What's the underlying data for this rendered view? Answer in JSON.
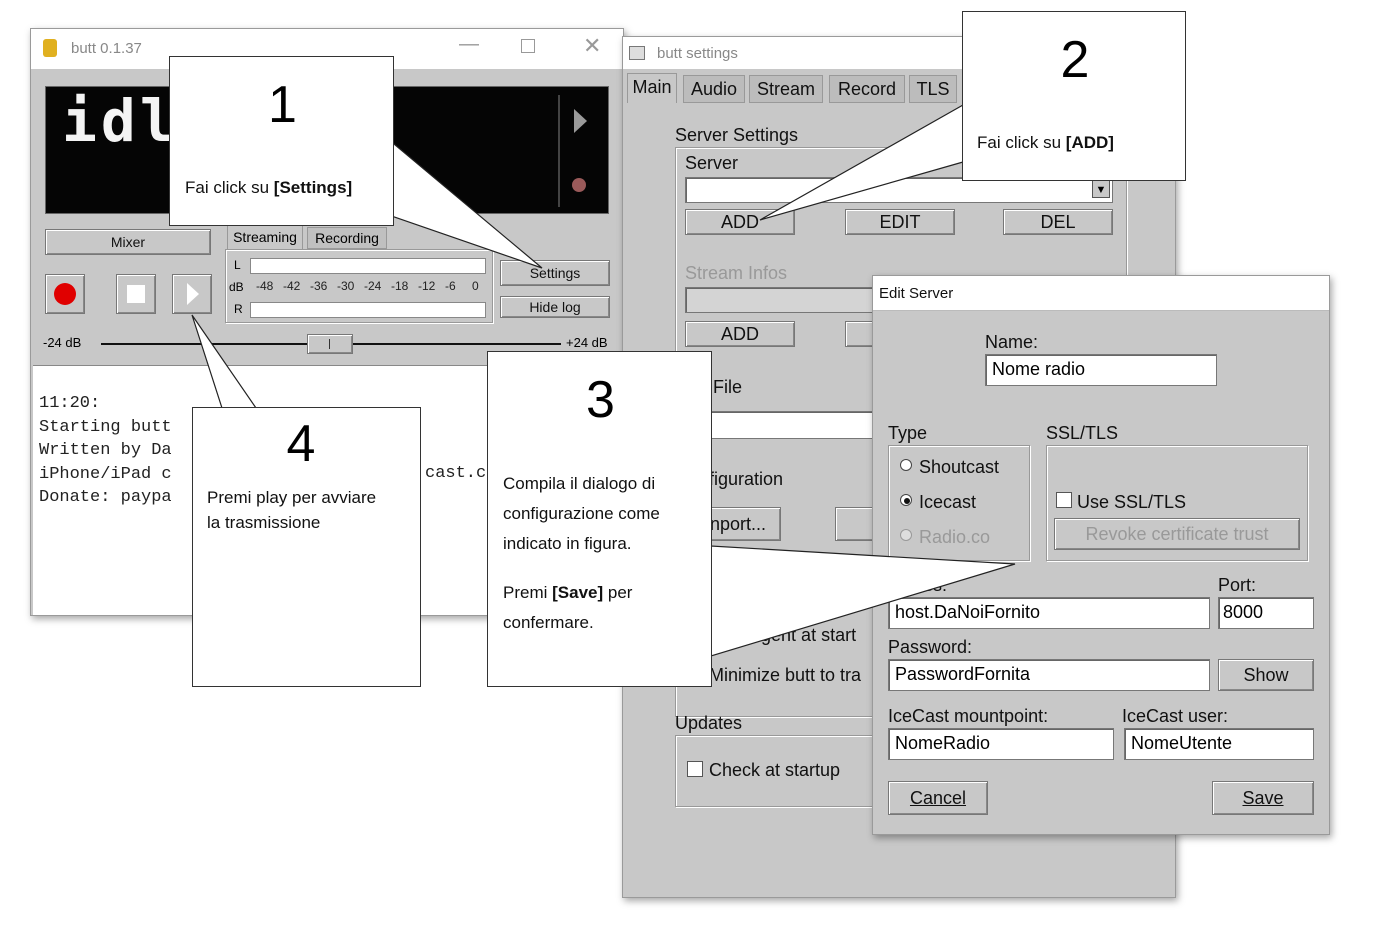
{
  "butt": {
    "title": "butt 0.1.37",
    "display_text": "idle",
    "mixer_label": "Mixer",
    "tabs": [
      "Streaming",
      "Recording"
    ],
    "vu_l": "L",
    "vu_db": "dB",
    "vu_r": "R",
    "vu_scale": [
      "-48",
      "-42",
      "-36",
      "-30",
      "-24",
      "-18",
      "-12",
      "-6",
      "0"
    ],
    "settings_label": "Settings",
    "hide_log_label": "Hide log",
    "gain_min": "-24 dB",
    "gain_max": "+24 dB",
    "log_lines": [
      "11:20:",
      "Starting butt",
      "Written by Da",
      "iPhone/iPad c",
      "Donate: paypa"
    ],
    "log_fragment": "cast.c"
  },
  "settings": {
    "title": "butt settings",
    "tabs": [
      "Main",
      "Audio",
      "Stream",
      "Record",
      "TLS"
    ],
    "server_settings": "Server Settings",
    "server_label": "Server",
    "add": "ADD",
    "edit": "EDIT",
    "del": "DEL",
    "stream_infos": "Stream Infos",
    "add2": "ADD",
    "file_label": "File",
    "configuration": "figuration",
    "import": "nport...",
    "start_agent": "start agent at start",
    "minimize": "Minimize butt to tra",
    "updates": "Updates",
    "check_startup": "Check at startup"
  },
  "edit_server": {
    "title": "Edit Server",
    "name_label": "Name:",
    "name_value": "Nome radio",
    "type_label": "Type",
    "shoutcast": "Shoutcast",
    "icecast": "Icecast",
    "radioco": "Radio.co",
    "ssl_label": "SSL/TLS",
    "use_ssl": "Use SSL/TLS",
    "revoke": "Revoke certificate trust",
    "address_label": "ddress:",
    "address_value": "host.DaNoiFornito",
    "port_label": "Port:",
    "port_value": "8000",
    "password_label": "Password:",
    "password_value": "PasswordFornita",
    "show": "Show",
    "mount_label": "IceCast mountpoint:",
    "mount_value": "NomeRadio",
    "user_label": "IceCast user:",
    "user_value": "NomeUtente",
    "cancel": "Cancel",
    "save": "Save"
  },
  "callouts": {
    "c1": {
      "num": "1",
      "pre": "Fai click su ",
      "bold": "[Settings]"
    },
    "c2": {
      "num": "2",
      "pre": "Fai click su ",
      "bold": "[ADD]"
    },
    "c3": {
      "num": "3",
      "line1": "Compila il dialogo di",
      "line2": "configurazione come",
      "line3": "indicato in figura.",
      "pre": "Premi ",
      "bold": "[Save]",
      "post": " per",
      "line5": "confermare."
    },
    "c4": {
      "num": "4",
      "line1": "Premi play per avviare",
      "line2": "la trasmissione"
    }
  }
}
